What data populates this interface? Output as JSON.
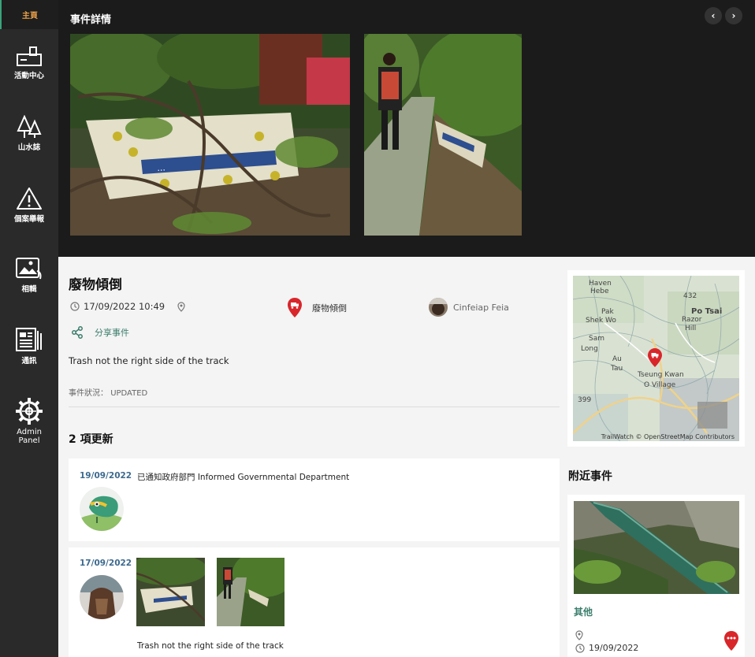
{
  "sidebar": {
    "home": "主頁",
    "items": [
      {
        "label": "活動中心",
        "icon": "activity-center-icon"
      },
      {
        "label": "山水誌",
        "icon": "trees-icon"
      },
      {
        "label": "個案舉報",
        "icon": "warning-icon"
      },
      {
        "label": "相輯",
        "icon": "photo-album-icon"
      },
      {
        "label": "通訊",
        "icon": "newsletter-icon"
      },
      {
        "label": "Admin\nPanel",
        "icon": "gear-icon"
      }
    ]
  },
  "header": {
    "title": "事件詳情",
    "prev": "‹",
    "next": "›"
  },
  "event": {
    "title": "廢物傾倒",
    "datetime": "17/09/2022 10:49",
    "category": "廢物傾倒",
    "reporter": "Cinfeiap Feia",
    "share_label": "分享事件",
    "description": "Trash not the right side of the track",
    "status_label": "事件狀況：",
    "status_value": "UPDATED"
  },
  "updates": {
    "heading": "2 項更新",
    "items": [
      {
        "date": "19/09/2022",
        "text": "已通知政府部門 Informed Governmental Department"
      },
      {
        "date": "17/09/2022",
        "text": "Trash not the right side of the track"
      }
    ]
  },
  "map": {
    "attribution": "TrailWatch © OpenStreetMap Contributors",
    "labels": [
      "Hebe",
      "Haven",
      "Pak",
      "Shek Wo",
      "Sam",
      "Long",
      "Au",
      "Tau",
      "Tseung Kwan",
      "O Village",
      "Razor",
      "Hill",
      "Po Tsai",
      "432",
      "399"
    ]
  },
  "nearby": {
    "heading": "附近事件",
    "category": "其他",
    "date": "19/09/2022"
  },
  "colors": {
    "sidebar_bg": "#2a2a2a",
    "header_bg": "#1b1b1b",
    "accent_green": "#3b7d6b",
    "marker_red": "#d8262b",
    "date_blue": "#3d6a8f"
  }
}
